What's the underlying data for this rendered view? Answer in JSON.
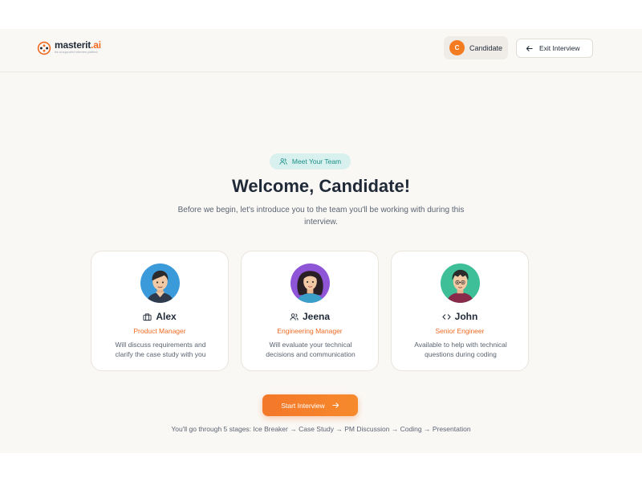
{
  "brand": {
    "name": "masterit",
    "suffix": ".ai",
    "tagline": "the ai-supported interview platform"
  },
  "header": {
    "candidate_initial": "C",
    "candidate_label": "Candidate",
    "exit_label": "Exit Interview"
  },
  "hero": {
    "badge": "Meet Your Team",
    "title": "Welcome, Candidate!",
    "subtitle": "Before we begin, let's introduce you to the team you'll be working with during this interview."
  },
  "team": [
    {
      "name": "Alex",
      "role": "Product Manager",
      "desc": "Will discuss requirements and clarify the case study with you",
      "icon": "briefcase-icon"
    },
    {
      "name": "Jeena",
      "role": "Engineering Manager",
      "desc": "Will evaluate your technical decisions and communication",
      "icon": "users-icon"
    },
    {
      "name": "John",
      "role": "Senior Engineer",
      "desc": "Available to help with technical questions during coding",
      "icon": "code-icon"
    }
  ],
  "actions": {
    "start_label": "Start Interview"
  },
  "footer": {
    "stages": "You'll go through 5 stages: Ice Breaker → Case Study → PM Discussion → Coding → Presentation"
  },
  "colors": {
    "accent": "#f06a22",
    "teal": "#1b8f87",
    "background": "#faf8f5"
  }
}
